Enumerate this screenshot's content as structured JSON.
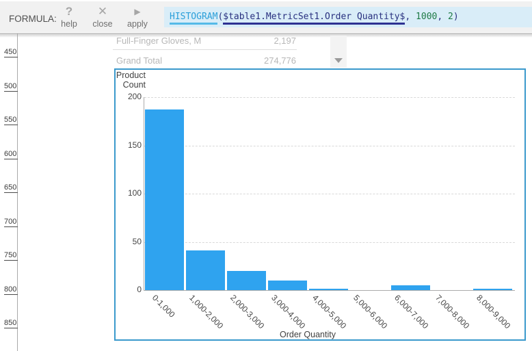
{
  "toolbar": {
    "label": "FORMULA:",
    "buttons": [
      {
        "id": "help",
        "icon": "?",
        "label": "help"
      },
      {
        "id": "close",
        "icon": "✕",
        "label": "close"
      },
      {
        "id": "apply",
        "icon": "▶",
        "label": "apply"
      }
    ],
    "formula": {
      "function": "HISTOGRAM",
      "open": "(",
      "field": "$table1.MetricSet1.Order Quantity$",
      "comma1": ", ",
      "arg_bin_size": "1000",
      "comma2": ", ",
      "arg_precision": "2",
      "close": ")"
    }
  },
  "ruler": {
    "ticks": [
      "450",
      "500",
      "550",
      "600",
      "650",
      "700",
      "750",
      "800",
      "850"
    ]
  },
  "table_preview": {
    "rows": [
      {
        "label": "Full-Finger Gloves, M",
        "value": "2,197"
      },
      {
        "label": "Grand Total",
        "value": "274,776"
      }
    ]
  },
  "chart_data": {
    "type": "bar",
    "title": "",
    "ylabel": "Product Count",
    "xlabel": "Order Quantity",
    "categories": [
      "0-1,000",
      "1,000-2,000",
      "2,000-3,000",
      "3,000-4,000",
      "4,000-5,000",
      "5,000-6,000",
      "6,000-7,000",
      "7,000-8,000",
      "8,000-9,000"
    ],
    "values": [
      187,
      41,
      20,
      10,
      1,
      0,
      5,
      0,
      1
    ],
    "ylim": [
      0,
      200
    ],
    "yticks": [
      0,
      50,
      100,
      150,
      200
    ],
    "grid": "horizontal-dashed",
    "legend": "none",
    "bar_color": "#2fa3ef"
  },
  "colors": {
    "accent_blue": "#2fa3ef",
    "chart_border": "#3a99cc",
    "formula_bg": "#d9edf8",
    "formula_function": "#2b9fd9",
    "formula_field_ref": "#28307f",
    "formula_number": "#1d7a45",
    "toolbar_bg": "#f1f1f1"
  }
}
